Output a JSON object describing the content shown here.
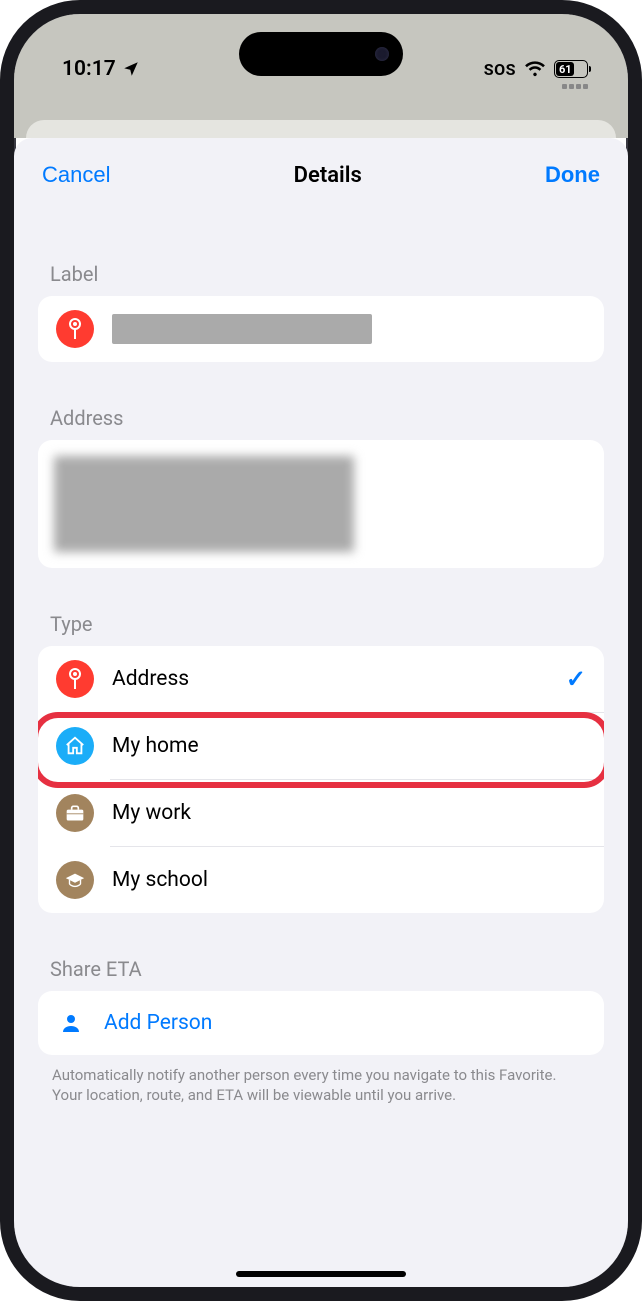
{
  "status": {
    "time": "10:17",
    "sos": "SOS",
    "battery": "61"
  },
  "nav": {
    "cancel": "Cancel",
    "title": "Details",
    "done": "Done"
  },
  "sections": {
    "label_header": "Label",
    "address_header": "Address",
    "type_header": "Type",
    "share_header": "Share ETA"
  },
  "types": [
    {
      "label": "Address",
      "selected": true
    },
    {
      "label": "My home",
      "selected": false
    },
    {
      "label": "My work",
      "selected": false
    },
    {
      "label": "My school",
      "selected": false
    }
  ],
  "share": {
    "add_person": "Add Person",
    "footnote": "Automatically notify another person every time you navigate to this Favorite. Your location, route, and ETA will be viewable until you arrive."
  }
}
